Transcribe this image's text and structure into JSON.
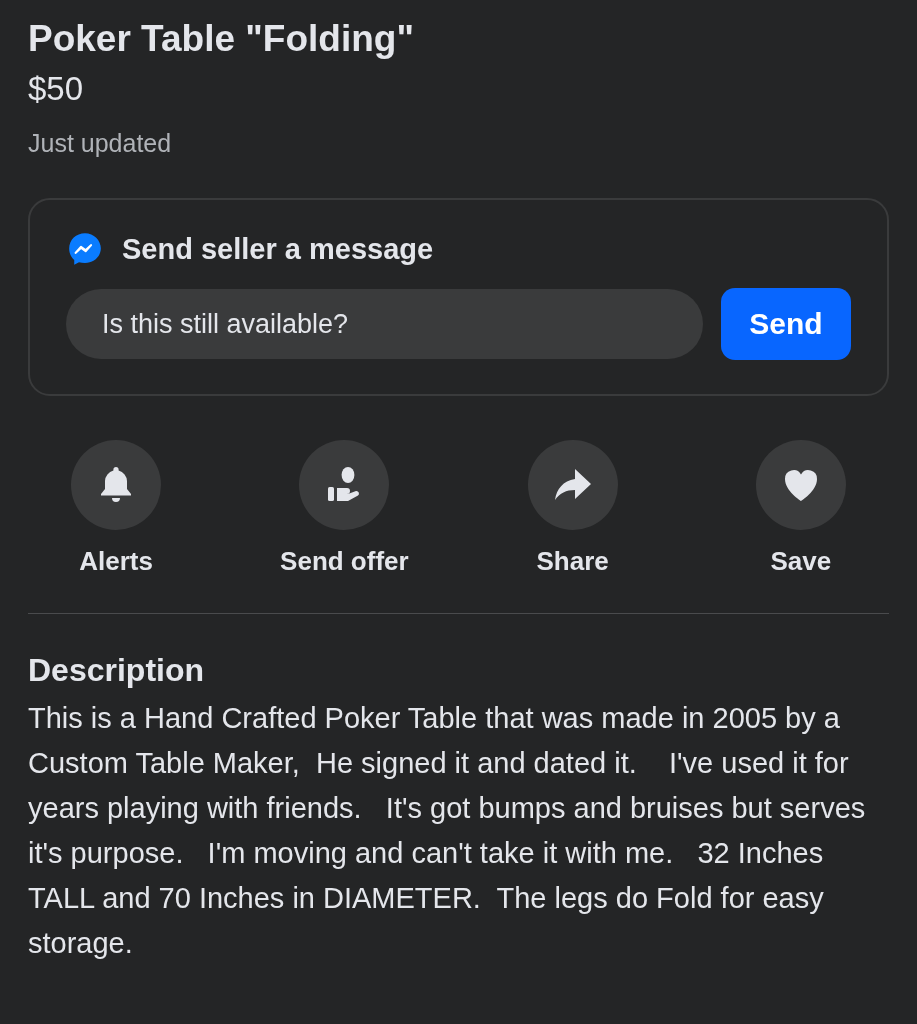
{
  "listing": {
    "title": "Poker Table \"Folding\"",
    "price": "$50",
    "updated": "Just updated"
  },
  "message": {
    "heading": "Send seller a message",
    "value": "Is this still available?",
    "send": "Send"
  },
  "actions": [
    {
      "kind": "bell",
      "label": "Alerts"
    },
    {
      "kind": "offer",
      "label": "Send offer"
    },
    {
      "kind": "share",
      "label": "Share"
    },
    {
      "kind": "heart",
      "label": "Save"
    }
  ],
  "description": {
    "heading": "Description",
    "text": "This is a Hand Crafted Poker Table that was made in 2005 by a Custom Table Maker,  He signed it and dated it.    I've used it for years playing with friends.   It's got bumps and bruises but serves it's purpose.   I'm moving and can't take it with me.   32 Inches TALL and 70 Inches in DIAMETER.  The legs do Fold for easy storage."
  }
}
